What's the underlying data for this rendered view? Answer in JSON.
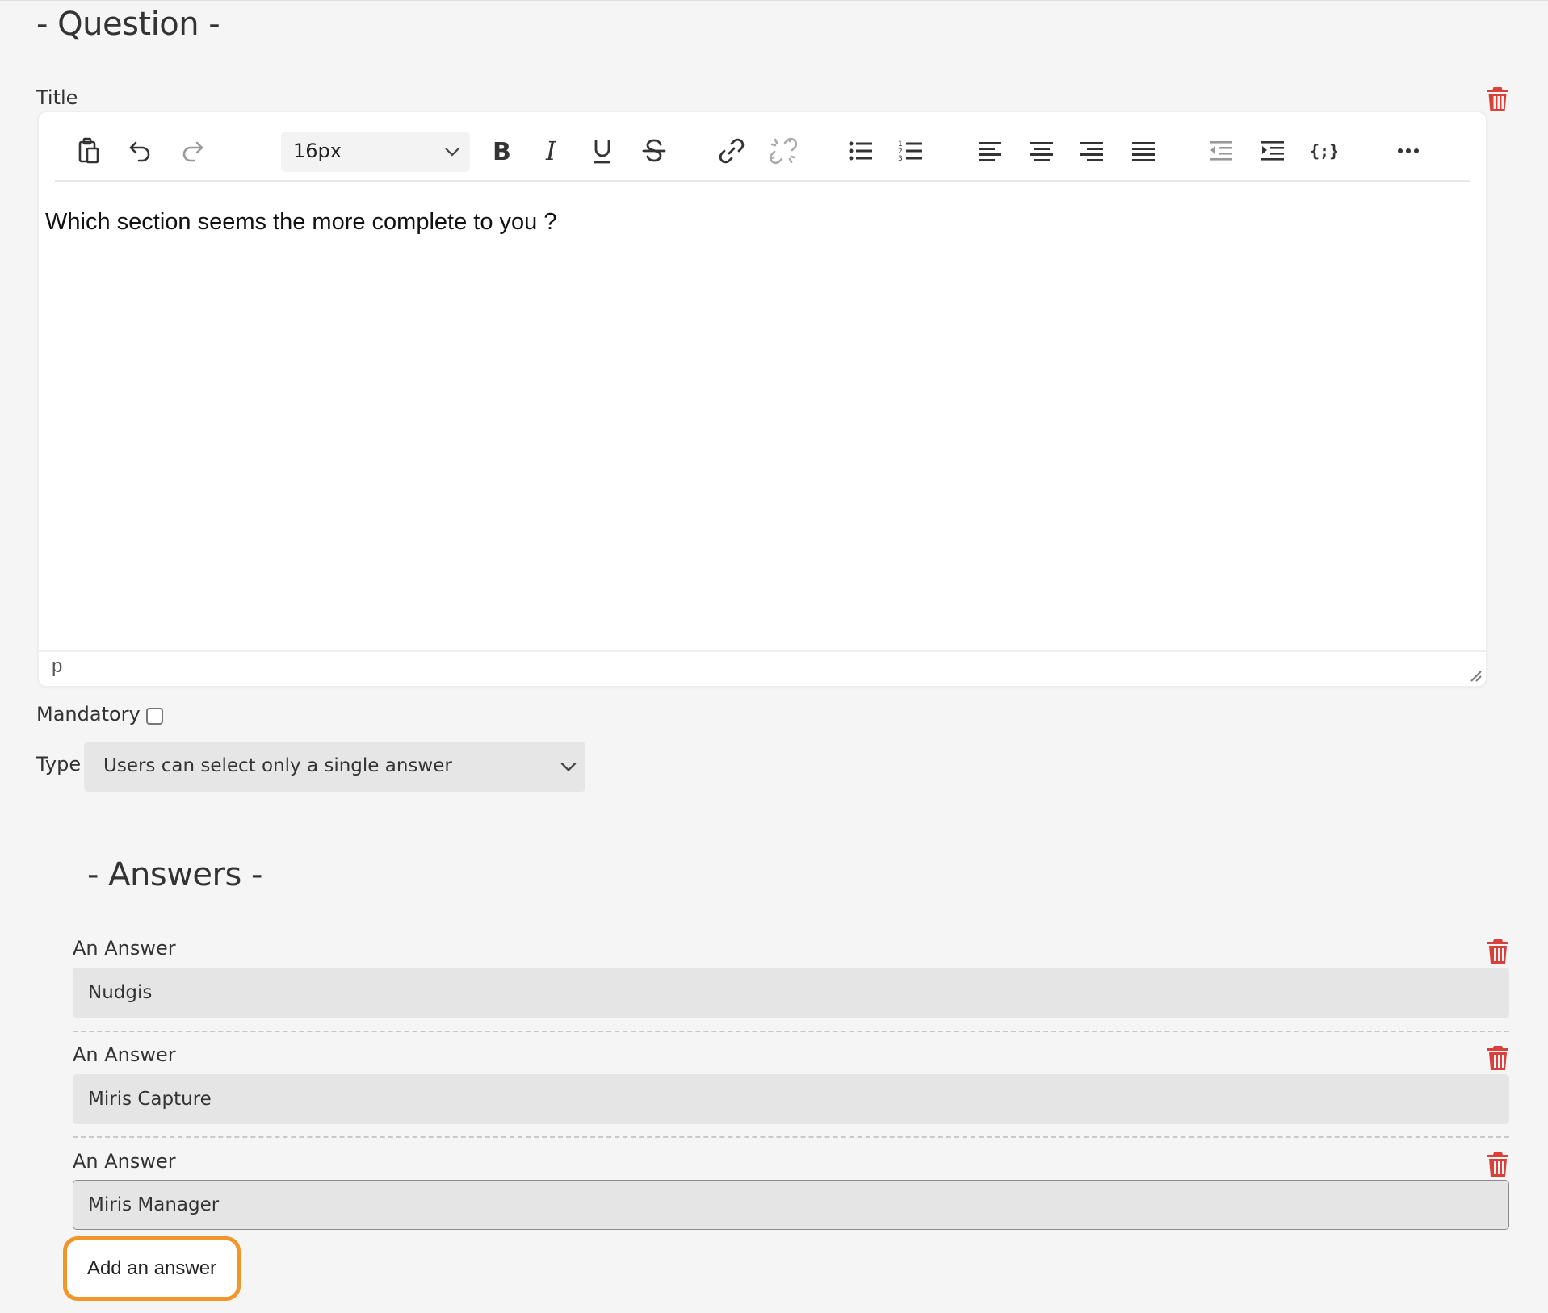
{
  "question": {
    "heading": "- Question -",
    "title_label": "Title",
    "editor": {
      "font_size": "16px",
      "content": "Which section seems the more complete to you ?",
      "status_path": "p",
      "toolbar_icons": [
        "paste-icon",
        "undo-icon",
        "redo-icon",
        "bold-icon",
        "italic-icon",
        "underline-icon",
        "strikethrough-icon",
        "link-icon",
        "unlink-icon",
        "bullet-list-icon",
        "numbered-list-icon",
        "align-left-icon",
        "align-center-icon",
        "align-right-icon",
        "align-justify-icon",
        "outdent-icon",
        "indent-icon",
        "code-icon",
        "more-icon"
      ]
    },
    "mandatory_label": "Mandatory",
    "mandatory_checked": false,
    "type_label": "Type",
    "type_value": "Users can select only a single answer"
  },
  "answers": {
    "heading": "- Answers -",
    "items": [
      {
        "label": "An Answer",
        "value": "Nudgis"
      },
      {
        "label": "An Answer",
        "value": "Miris Capture"
      },
      {
        "label": "An Answer",
        "value": "Miris Manager"
      }
    ],
    "add_label": "Add an answer"
  },
  "colors": {
    "trash": "#d9403a",
    "highlight": "#f0962a",
    "background": "#f5f5f5"
  }
}
